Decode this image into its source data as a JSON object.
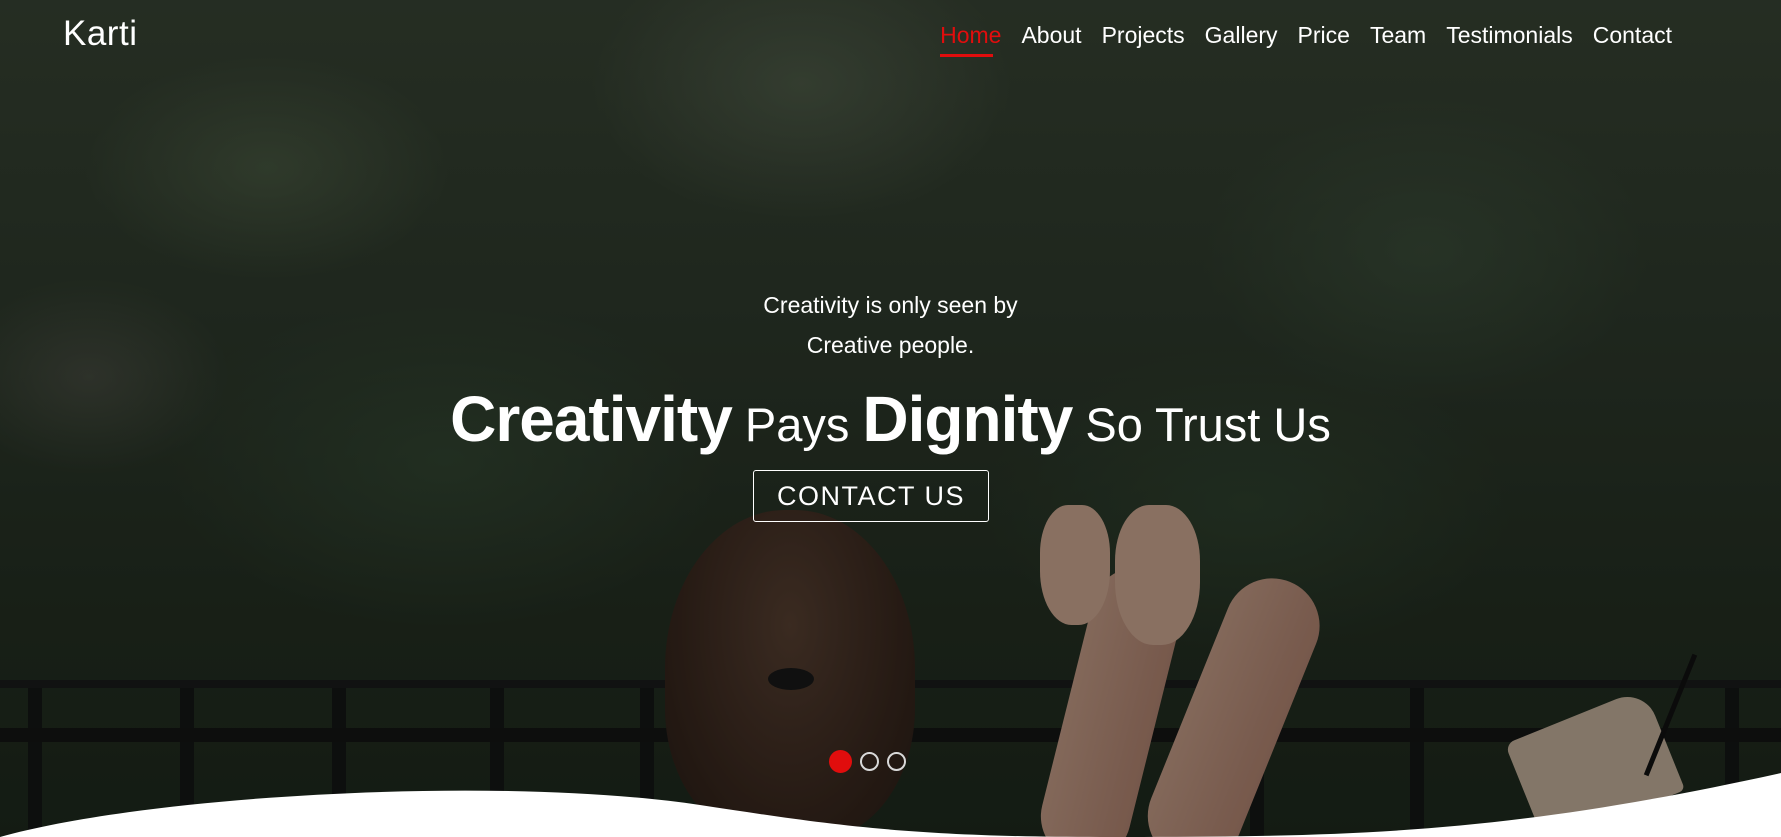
{
  "brand": {
    "name": "Karti"
  },
  "nav": {
    "items": [
      {
        "label": "Home",
        "active": true
      },
      {
        "label": "About",
        "active": false
      },
      {
        "label": "Projects",
        "active": false
      },
      {
        "label": "Gallery",
        "active": false
      },
      {
        "label": "Price",
        "active": false
      },
      {
        "label": "Team",
        "active": false
      },
      {
        "label": "Testimonials",
        "active": false
      },
      {
        "label": "Contact",
        "active": false
      }
    ]
  },
  "hero": {
    "tagline_line1": "Creativity is only seen by",
    "tagline_line2": "Creative people.",
    "headline": {
      "word1": "Creativity",
      "word2": "Pays",
      "word3": "Dignity",
      "word4": "So Trust Us"
    },
    "cta_label": "CONTACT US"
  },
  "slider": {
    "count": 3,
    "active_index": 0
  },
  "colors": {
    "accent": "#e10d0d",
    "text": "#ffffff",
    "wave": "#ffffff"
  }
}
